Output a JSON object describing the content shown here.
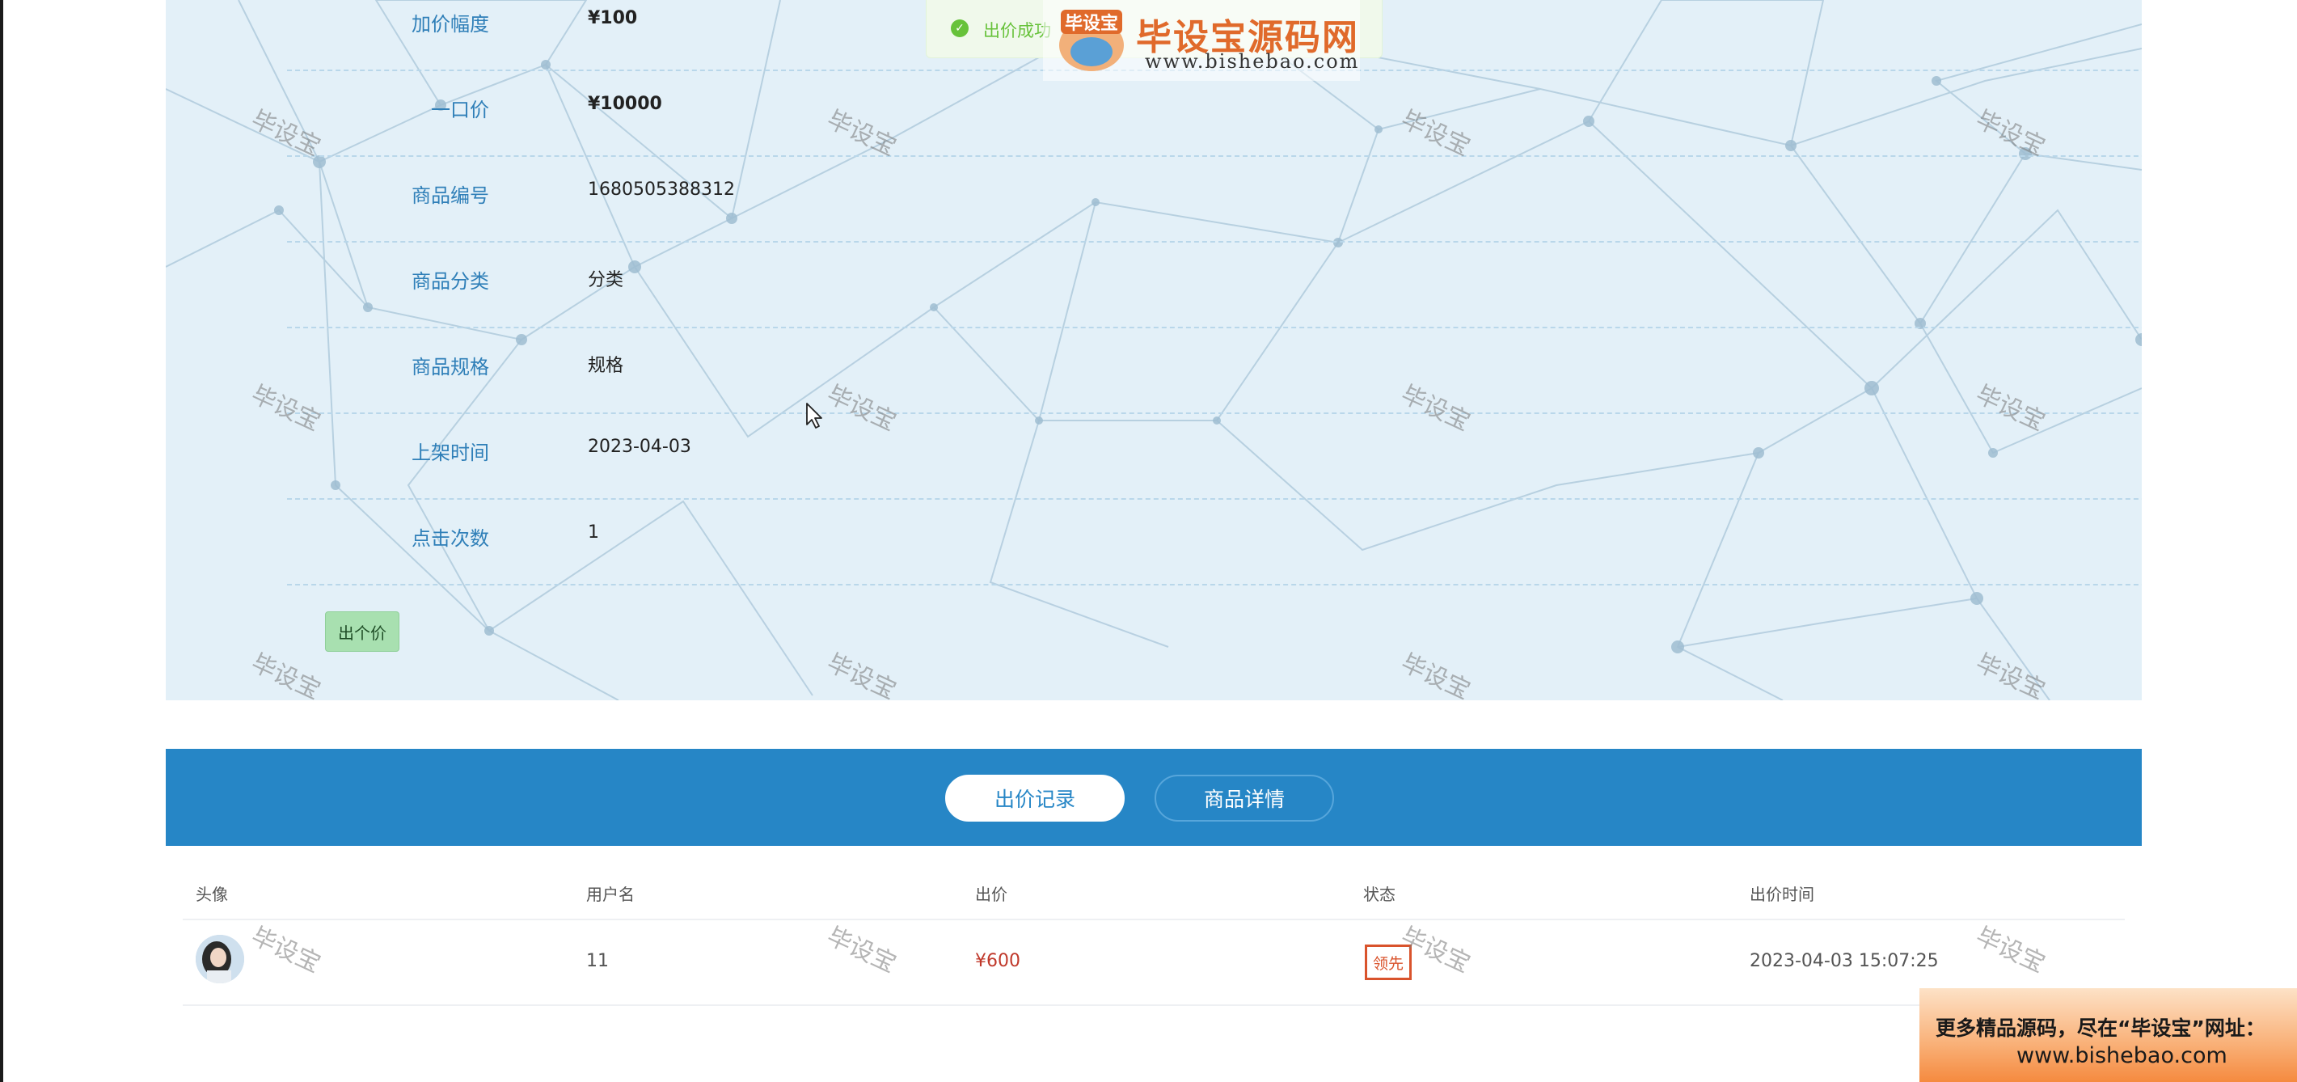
{
  "info": {
    "rows": [
      {
        "label": "加价幅度",
        "value": "¥100",
        "bold": true
      },
      {
        "label": "一口价",
        "value": "¥10000",
        "bold": true
      },
      {
        "label": "商品编号",
        "value": "1680505388312",
        "bold": false
      },
      {
        "label": "商品分类",
        "value": "分类",
        "bold": false
      },
      {
        "label": "商品规格",
        "value": "规格",
        "bold": false
      },
      {
        "label": "上架时间",
        "value": "2023-04-03",
        "bold": false
      },
      {
        "label": "点击次数",
        "value": "1",
        "bold": false
      }
    ],
    "bid_button": "出个价"
  },
  "toast": {
    "text": "出价成功",
    "icon": "check-circle-icon",
    "color": "#67c23a"
  },
  "logo": {
    "badge_text": "毕设宝",
    "title": "毕设宝源码网",
    "url": "www.bishebao.com"
  },
  "tabs": [
    {
      "label": "出价记录",
      "active": true
    },
    {
      "label": "商品详情",
      "active": false
    }
  ],
  "table": {
    "headers": [
      "头像",
      "用户名",
      "出价",
      "状态",
      "出价时间"
    ],
    "rows": [
      {
        "username": "11",
        "price": "¥600",
        "status": "领先",
        "time": "2023-04-03 15:07:25"
      }
    ]
  },
  "watermark_text": "毕设宝",
  "promo": {
    "line1": "更多精品源码，尽在“毕设宝”网址：",
    "line2": "www.bishebao.com"
  },
  "colors": {
    "accent": "#2686c6",
    "label": "#2f7fb8",
    "panel_bg": "#e3f0f8",
    "status": "#d9532c",
    "price": "#c0392b"
  }
}
